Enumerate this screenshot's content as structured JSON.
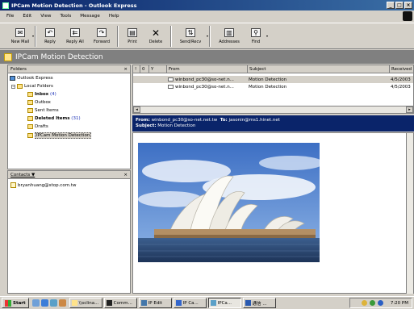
{
  "window": {
    "title": "IPCam Motion Detection - Outlook Express"
  },
  "menu": [
    "File",
    "Edit",
    "View",
    "Tools",
    "Message",
    "Help"
  ],
  "toolbar": [
    {
      "label": "New Mail",
      "icon": "new-mail-icon"
    },
    {
      "label": "Reply",
      "icon": "reply-icon"
    },
    {
      "label": "Reply All",
      "icon": "reply-all-icon"
    },
    {
      "label": "Forward",
      "icon": "forward-icon"
    },
    {
      "label": "Print",
      "icon": "print-icon"
    },
    {
      "label": "Delete",
      "icon": "delete-icon"
    },
    {
      "label": "Send/Recv",
      "icon": "send-receive-icon"
    },
    {
      "label": "Addresses",
      "icon": "addresses-icon"
    },
    {
      "label": "Find",
      "icon": "find-icon"
    }
  ],
  "folder_bar": {
    "title": "IPCam Motion Detection"
  },
  "folders_pane": {
    "header": "Folders",
    "close": "×",
    "items": [
      {
        "label": "Outlook Express",
        "count": ""
      },
      {
        "label": "Local Folders",
        "count": ""
      },
      {
        "label": "Inbox",
        "count": "(4)"
      },
      {
        "label": "Outbox",
        "count": ""
      },
      {
        "label": "Sent Items",
        "count": ""
      },
      {
        "label": "Deleted Items",
        "count": "(31)"
      },
      {
        "label": "Drafts",
        "count": ""
      },
      {
        "label": "IPCam Motion Detection",
        "count": ""
      }
    ]
  },
  "contacts_pane": {
    "header": "Contacts ▼",
    "close": "×",
    "items": [
      "bryanhuang@stop.com.tw"
    ]
  },
  "message_list": {
    "columns": {
      "flag1": "!",
      "flag2": "0",
      "flag3": "Y",
      "from": "From",
      "subject": "Subject",
      "received": "Received"
    },
    "rows": [
      {
        "from": "winbond_pc30@so-net.n...",
        "subject": "Motion Detection",
        "received": "4/5/2003"
      },
      {
        "from": "winbond_pc30@so-net.n...",
        "subject": "Motion Detection",
        "received": "4/5/2003"
      }
    ]
  },
  "preview": {
    "from_label": "From:",
    "from": "winbond_pc30@so-net.net.tw",
    "to_label": "To:",
    "to": "jasonin@ms1.hinet.net",
    "subject_label": "Subject:",
    "subject": "Motion Detection"
  },
  "taskbar": {
    "start": "Start",
    "tasks": [
      "\\\\sclina...",
      "Comm...",
      "IP Edit",
      "IP Ca...",
      "IPCa...",
      "通信 ..."
    ],
    "clock": "7:20 PM"
  },
  "colors": {
    "title_bar": "#0a246a",
    "preview_header": "#0a246a",
    "folder_bar": "#808080",
    "face": "#d4d0c8"
  }
}
